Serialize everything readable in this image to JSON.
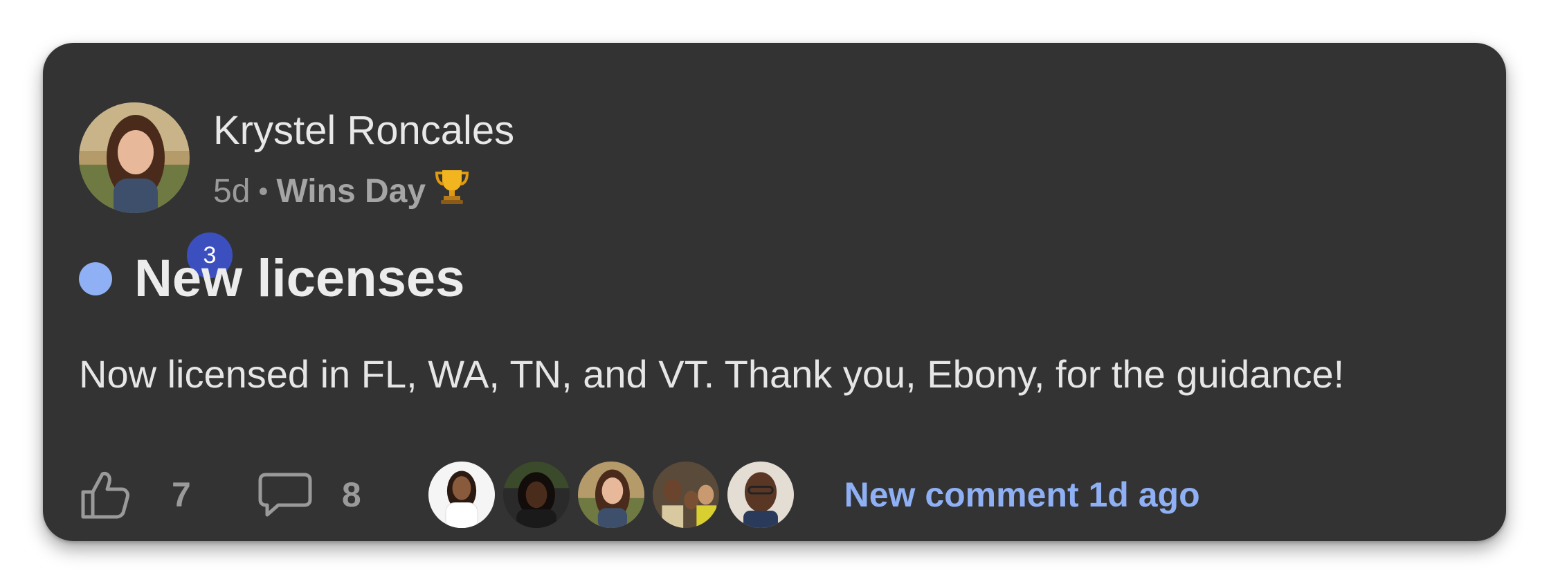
{
  "post": {
    "author": {
      "name": "Krystel Roncales",
      "level": "3"
    },
    "time_ago": "5d",
    "separator": "•",
    "category": "Wins Day",
    "category_icon": "trophy-icon",
    "title": "New licenses",
    "body": "Now licensed in FL, WA, TN, and VT. Thank you, Ebony, for the guidance!",
    "likes": "7",
    "comments": "8",
    "new_comment": "New comment 1d ago"
  },
  "colors": {
    "card_bg": "#333333",
    "accent_blue": "#8fb0f4",
    "level_badge": "#3c4fbf"
  }
}
